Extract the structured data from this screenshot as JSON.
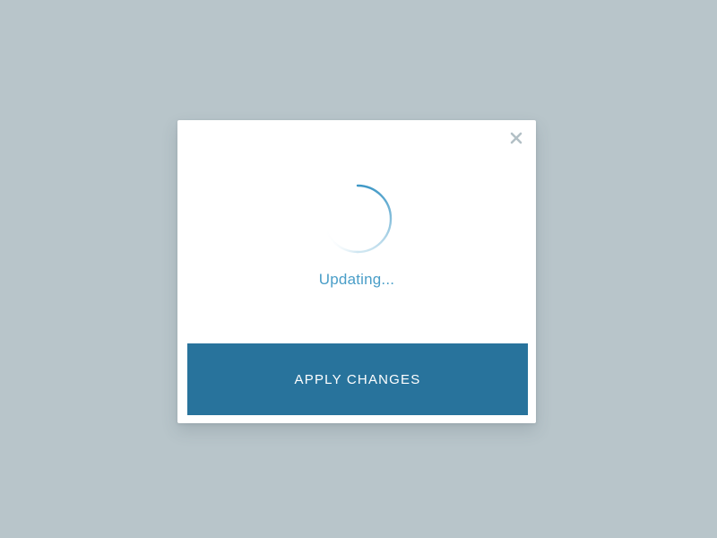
{
  "dialog": {
    "status_text": "Updating...",
    "apply_button_label": "APPLY CHANGES"
  },
  "icons": {
    "close": "close-icon",
    "spinner": "loading-spinner-icon"
  },
  "colors": {
    "background": "#b8c5ca",
    "dialog": "#ffffff",
    "accent": "#4a9ec8",
    "button": "#28739c",
    "close_icon": "#b8c5ca"
  }
}
